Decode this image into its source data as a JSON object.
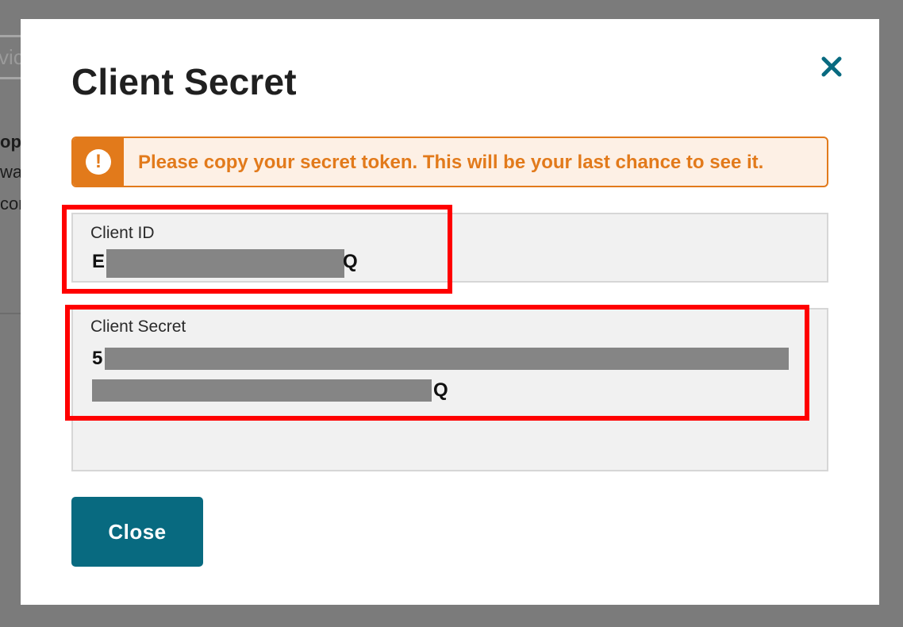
{
  "background": {
    "tab_partial": "vic",
    "text_line_1": "opp",
    "text_line_2": "way",
    "text_line_3": "cor"
  },
  "modal": {
    "title": "Client Secret",
    "close_icon": "close-x-icon",
    "alert": {
      "icon": "exclamation-icon",
      "text": "Please copy your secret token. This will be your last chance to see it."
    },
    "client_id": {
      "label": "Client ID",
      "value_start": "E",
      "value_end": "Q"
    },
    "client_secret": {
      "label": "Client Secret",
      "value_start": "5",
      "value_end": "Q"
    },
    "close_button_label": "Close"
  },
  "colors": {
    "overlay": "#7b7b7b",
    "warning": "#e27a1b",
    "warning_bg": "#fdf0e5",
    "primary": "#086a80",
    "highlight": "#ff0000",
    "field_bg": "#f1f1f1"
  }
}
